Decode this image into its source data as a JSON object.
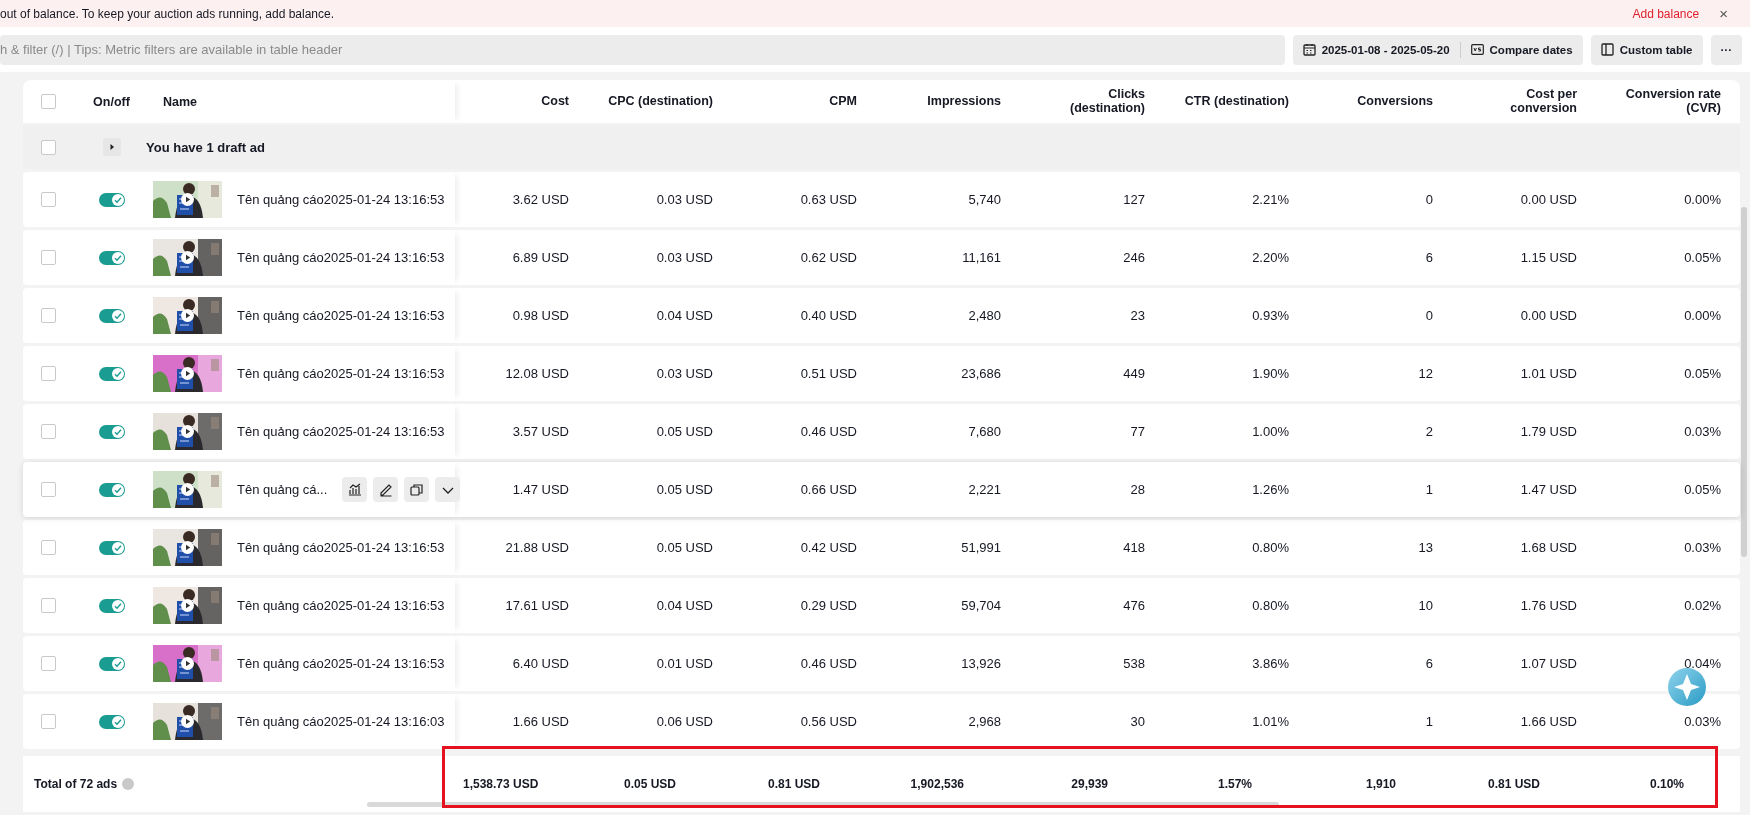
{
  "banner": {
    "message": "out of balance. To keep your auction ads running, add balance.",
    "action": "Add balance",
    "close": "×"
  },
  "toolbar": {
    "search_placeholder": "h & filter (/) | Tips: Metric filters are available in table header",
    "date_range": "2025-01-08 - 2025-05-20",
    "compare": "Compare dates",
    "custom": "Custom table",
    "more": "···"
  },
  "table": {
    "header_checked": false,
    "onoff_header": "On/off",
    "name_header": "Name",
    "columns": [
      "Cost",
      "CPC (destination)",
      "CPM",
      "Impressions",
      "Clicks\n(destination)",
      "CTR (destination)",
      "Conversions",
      "Cost per\nconversion",
      "Conversion rate\n(CVR)"
    ],
    "draft_row": {
      "text": "You have 1 draft ad",
      "checked": false,
      "expanded": false
    },
    "rows": [
      {
        "checked": false,
        "on": true,
        "hovered": false,
        "thumbnail": {
          "kind": "picture"
        },
        "name": "Tên quảng cáo2025-01-24 13:16:53",
        "cells": [
          "3.62 USD",
          "0.03 USD",
          "0.63 USD",
          "5,740",
          "127",
          "2.21%",
          "0",
          "0.00 USD",
          "0.00%"
        ]
      },
      {
        "checked": false,
        "on": true,
        "hovered": false,
        "thumbnail": {
          "kind": "picture"
        },
        "name": "Tên quảng cáo2025-01-24 13:16:53",
        "cells": [
          "6.89 USD",
          "0.03 USD",
          "0.62 USD",
          "11,161",
          "246",
          "2.20%",
          "6",
          "1.15 USD",
          "0.05%"
        ]
      },
      {
        "checked": false,
        "on": true,
        "hovered": false,
        "thumbnail": {
          "kind": "picture"
        },
        "name": "Tên quảng cáo2025-01-24 13:16:53",
        "cells": [
          "0.98 USD",
          "0.04 USD",
          "0.40 USD",
          "2,480",
          "23",
          "0.93%",
          "0",
          "0.00 USD",
          "0.00%"
        ]
      },
      {
        "checked": false,
        "on": true,
        "hovered": false,
        "thumbnail": {
          "kind": "picture"
        },
        "name": "Tên quảng cáo2025-01-24 13:16:53",
        "cells": [
          "12.08 USD",
          "0.03 USD",
          "0.51 USD",
          "23,686",
          "449",
          "1.90%",
          "12",
          "1.01 USD",
          "0.05%"
        ]
      },
      {
        "checked": false,
        "on": true,
        "hovered": false,
        "thumbnail": {
          "kind": "picture"
        },
        "name": "Tên quảng cáo2025-01-24 13:16:53",
        "cells": [
          "3.57 USD",
          "0.05 USD",
          "0.46 USD",
          "7,680",
          "77",
          "1.00%",
          "2",
          "1.79 USD",
          "0.03%"
        ]
      },
      {
        "checked": false,
        "on": true,
        "hovered": true,
        "thumbnail": {
          "kind": "picture"
        },
        "name": "Tên quảng cá...",
        "cells": [
          "1.47 USD",
          "0.05 USD",
          "0.66 USD",
          "2,221",
          "28",
          "1.26%",
          "1",
          "1.47 USD",
          "0.05%"
        ]
      },
      {
        "checked": false,
        "on": true,
        "hovered": false,
        "thumbnail": {
          "kind": "picture"
        },
        "name": "Tên quảng cáo2025-01-24 13:16:53",
        "cells": [
          "21.88 USD",
          "0.05 USD",
          "0.42 USD",
          "51,991",
          "418",
          "0.80%",
          "13",
          "1.68 USD",
          "0.03%"
        ]
      },
      {
        "checked": false,
        "on": true,
        "hovered": false,
        "thumbnail": {
          "kind": "picture"
        },
        "name": "Tên quảng cáo2025-01-24 13:16:53",
        "cells": [
          "17.61 USD",
          "0.04 USD",
          "0.29 USD",
          "59,704",
          "476",
          "0.80%",
          "10",
          "1.76 USD",
          "0.02%"
        ]
      },
      {
        "checked": false,
        "on": true,
        "hovered": false,
        "thumbnail": {
          "kind": "picture"
        },
        "name": "Tên quảng cáo2025-01-24 13:16:53",
        "cells": [
          "6.40 USD",
          "0.01 USD",
          "0.46 USD",
          "13,926",
          "538",
          "3.86%",
          "6",
          "1.07 USD",
          "0.04%"
        ]
      },
      {
        "checked": false,
        "on": true,
        "hovered": false,
        "thumbnail": {
          "kind": "picture"
        },
        "name": "Tên quảng cáo2025-01-24 13:16:03",
        "cells": [
          "1.66 USD",
          "0.06 USD",
          "0.56 USD",
          "2,968",
          "30",
          "1.01%",
          "1",
          "1.66 USD",
          "0.03%"
        ]
      }
    ],
    "footer": {
      "label": "Total of 72 ads",
      "values": [
        "1,538.73 USD",
        "0.05 USD",
        "0.81 USD",
        "1,902,536",
        "29,939",
        "1.57%",
        "1,910",
        "0.81 USD",
        "0.10%"
      ],
      "highlighted": true
    }
  }
}
